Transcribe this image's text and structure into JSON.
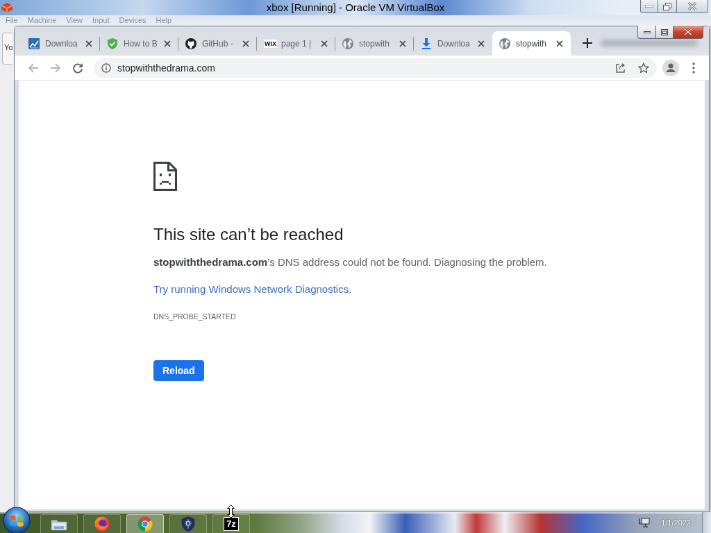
{
  "host_window": {
    "title": "xbox [Running] - Oracle VM VirtualBox",
    "menu": [
      "File",
      "Machine",
      "View",
      "Input",
      "Devices",
      "Help"
    ],
    "side_label": "Yo"
  },
  "browser": {
    "tabs": [
      {
        "title": "Downloa",
        "kind": "chart",
        "selected": false
      },
      {
        "title": "How to B",
        "kind": "shield",
        "selected": false
      },
      {
        "title": "GitHub -",
        "kind": "github",
        "selected": false
      },
      {
        "title": "page 1 |",
        "kind": "wix",
        "icon_text": "WIX",
        "selected": false
      },
      {
        "title": "stopwith",
        "kind": "globe",
        "selected": false
      },
      {
        "title": "Downloa",
        "kind": "download",
        "selected": false
      },
      {
        "title": "stopwith",
        "kind": "globe",
        "selected": true
      }
    ],
    "back_disabled": true,
    "forward_disabled": true,
    "address": "stopwiththedrama.com"
  },
  "error_page": {
    "heading": "This site can’t be reached",
    "message": "**stopwiththedrama.com**’s DNS address could not be found. Diagnosing the problem.",
    "suggestion_link": "Try running Windows Network Diagnostics",
    "suggestion_end": ".",
    "error_code": "DNS_PROBE_STARTED",
    "reload_button": "Reload"
  },
  "taskbar": {
    "apps": [
      {
        "kind": "folder",
        "active": false
      },
      {
        "kind": "firefox",
        "active": false
      },
      {
        "kind": "chrome",
        "active": true
      },
      {
        "kind": "shield",
        "active": false
      },
      {
        "kind": "archiver",
        "logo_text": "7z",
        "active": false
      }
    ],
    "date": "1/1/2022"
  }
}
